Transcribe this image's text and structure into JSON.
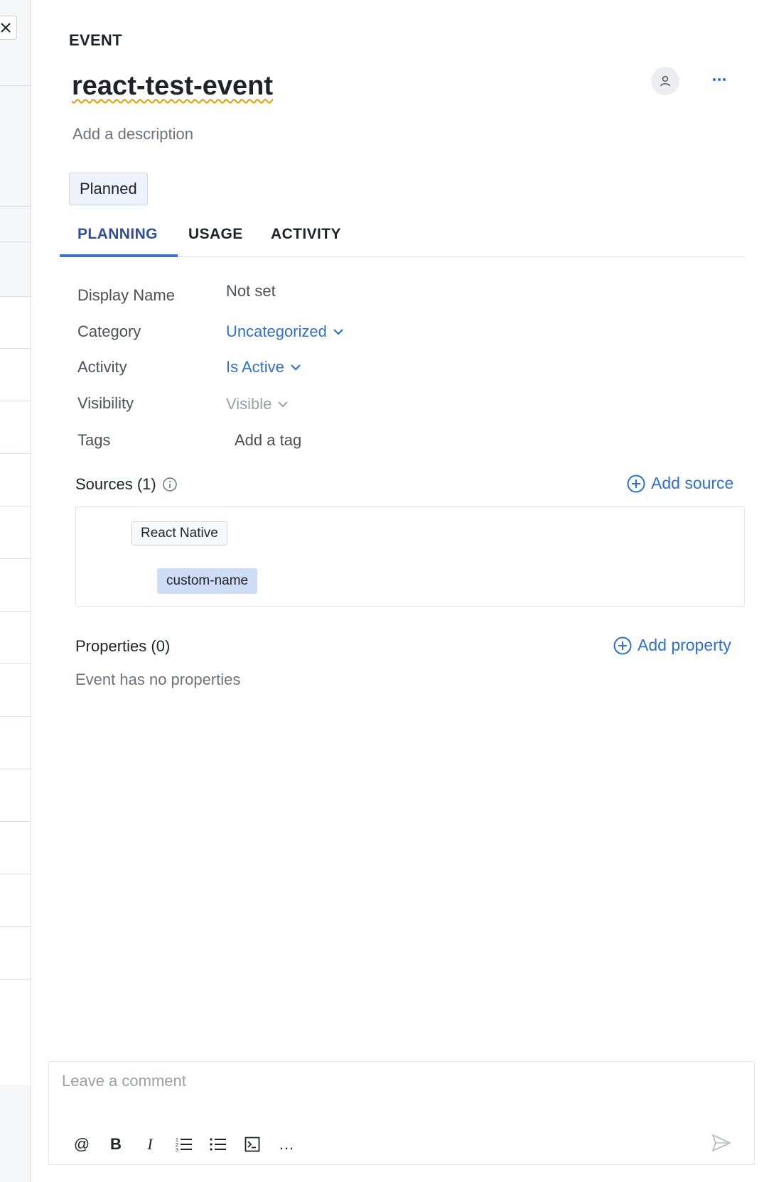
{
  "panel": {
    "eyebrow": "EVENT",
    "title": "react-test-event",
    "description_placeholder": "Add a description",
    "status": "Planned",
    "more_label": "···"
  },
  "tabs": [
    {
      "label": "PLANNING",
      "active": true
    },
    {
      "label": "USAGE",
      "active": false
    },
    {
      "label": "ACTIVITY",
      "active": false
    }
  ],
  "fields": {
    "display_name": {
      "label": "Display Name",
      "value": "Not set"
    },
    "category": {
      "label": "Category",
      "value": "Uncategorized"
    },
    "activity": {
      "label": "Activity",
      "value": "Is Active"
    },
    "visibility": {
      "label": "Visibility",
      "value": "Visible"
    },
    "tags": {
      "label": "Tags",
      "value": "Add a tag"
    }
  },
  "sources": {
    "heading": "Sources (1)",
    "add_label": "Add source",
    "items": [
      {
        "platform": "React Native",
        "name": "custom-name"
      }
    ]
  },
  "properties": {
    "heading": "Properties (0)",
    "add_label": "Add property",
    "empty_text": "Event has no properties"
  },
  "comment": {
    "placeholder": "Leave a comment",
    "toolbar": [
      "@",
      "B",
      "I",
      "ordered-list-icon",
      "bullet-list-icon",
      "code-block-icon",
      "…"
    ]
  },
  "colors": {
    "accent": "#2f6fd6",
    "tab_active": "#2d4fa0",
    "tab_underline": "#3b6fd4",
    "name_chip_bg": "#cfdcf5",
    "status_chip_bg": "#eef3fb",
    "title_underline": "#e5a000"
  }
}
